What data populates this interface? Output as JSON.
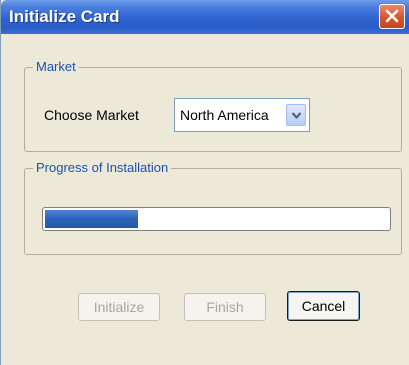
{
  "window": {
    "title": "Initialize Card"
  },
  "market": {
    "legend": "Market",
    "choose_label": "Choose Market",
    "selected": "North America"
  },
  "progress": {
    "legend": "Progress of Installation",
    "fraction": 0.27
  },
  "buttons": {
    "initialize": "Initialize",
    "finish": "Finish",
    "cancel": "Cancel"
  },
  "icons": {
    "close": "close-icon",
    "dropdown": "chevron-down-icon"
  },
  "colors": {
    "titlebar": "#2f63d0",
    "legend_text": "#1d4fb4",
    "progress_fill": "#2d63b7",
    "close_button": "#d6552d"
  }
}
